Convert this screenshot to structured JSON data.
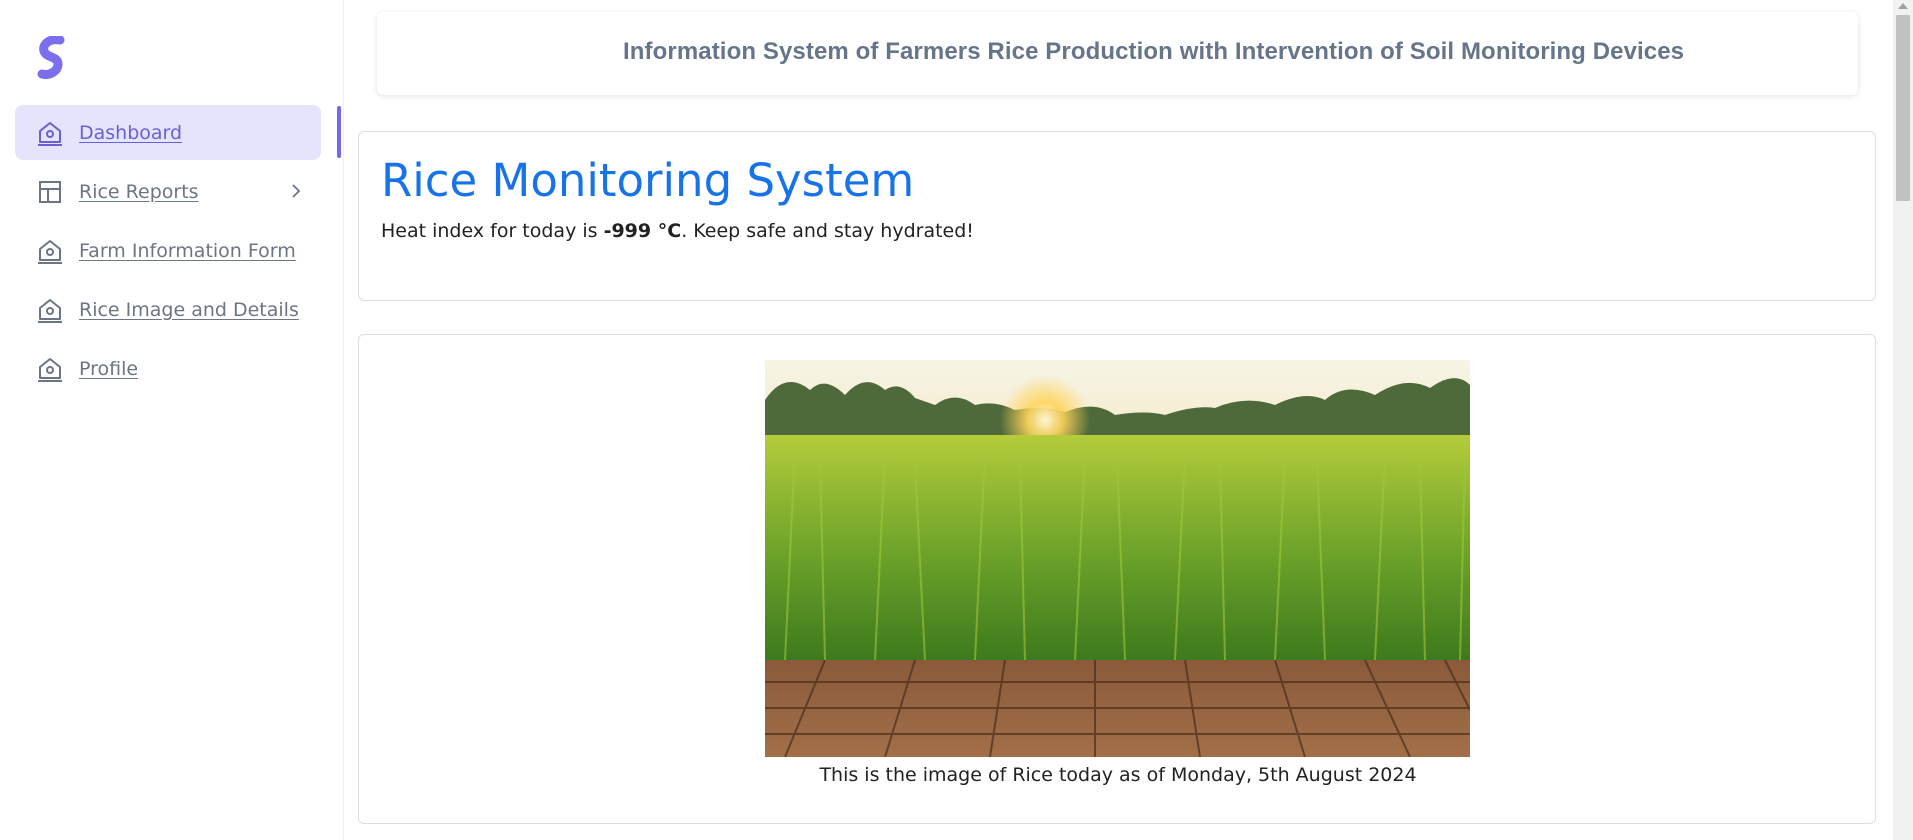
{
  "app": {
    "logo_icon": "brand-s-logo-icon",
    "brand_color": "#7b6ff0"
  },
  "sidebar": {
    "items": [
      {
        "label": "Dashboard",
        "icon": "home-icon",
        "active": true
      },
      {
        "label": "Rice Reports",
        "icon": "layout-icon",
        "has_submenu": true
      },
      {
        "label": "Farm Information Form",
        "icon": "home-icon"
      },
      {
        "label": "Rice Image and Details",
        "icon": "home-icon"
      },
      {
        "label": "Profile",
        "icon": "home-icon"
      }
    ]
  },
  "header": {
    "title": "Information System of Farmers Rice Production with Intervention of Soil Monitoring Devices"
  },
  "hero": {
    "title": "Rice Monitoring System",
    "heat_prefix": "Heat index for today is ",
    "heat_value": "-999 °C",
    "heat_suffix": ". Keep safe and stay hydrated!"
  },
  "rice_image": {
    "icon": "rice-field-photo",
    "caption": "This is the image of Rice today as of Monday, 5th August 2024"
  },
  "colors": {
    "accent": "#6f6af0",
    "title_blue": "#1973e8",
    "active_bg": "#e5e4fd",
    "header_text": "#66758a"
  }
}
